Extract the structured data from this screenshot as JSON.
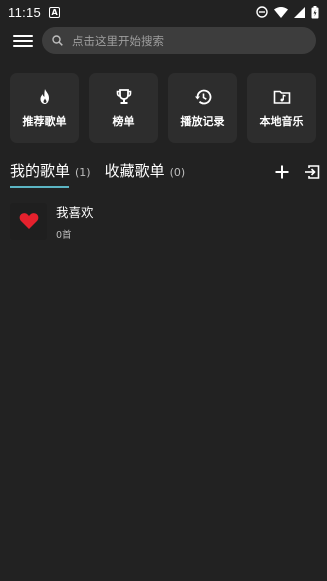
{
  "status_bar": {
    "time": "11:15",
    "app_badge": "A"
  },
  "search": {
    "placeholder": "点击这里开始搜索"
  },
  "quick_access": [
    {
      "label": "推荐歌单",
      "icon": "fire-icon"
    },
    {
      "label": "榜单",
      "icon": "trophy-icon"
    },
    {
      "label": "播放记录",
      "icon": "history-icon"
    },
    {
      "label": "本地音乐",
      "icon": "music-folder-icon"
    }
  ],
  "tabs": [
    {
      "label": "我的歌单",
      "count": "(1)",
      "active": true
    },
    {
      "label": "收藏歌单",
      "count": "(0)",
      "active": false
    }
  ],
  "playlists": [
    {
      "title": "我喜欢",
      "subtitle": "0首",
      "icon": "heart-icon"
    }
  ],
  "colors": {
    "background": "#222222",
    "card": "#2d2d2d",
    "search_bg": "#3d3d3d",
    "tab_indicator": "#5bb5c3",
    "heart": "#e5212d"
  }
}
